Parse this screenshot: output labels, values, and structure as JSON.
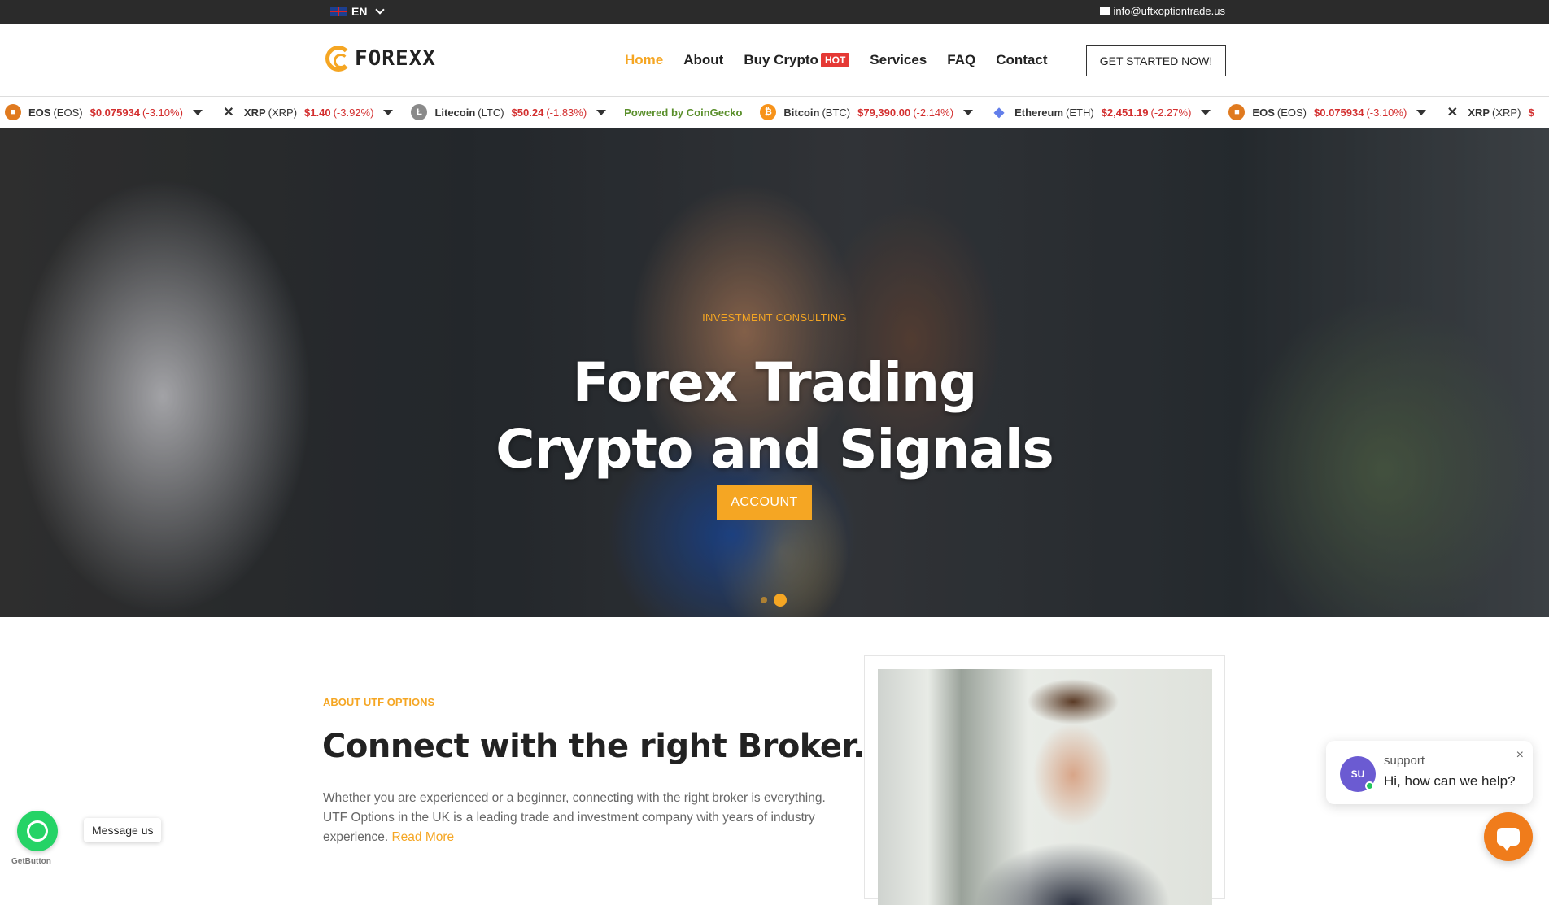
{
  "topbar": {
    "language": "EN",
    "email": "info@uftxoptiontrade.us"
  },
  "header": {
    "logo_text": "FOREXX",
    "nav": [
      {
        "label": "Home",
        "active": true
      },
      {
        "label": "About"
      },
      {
        "label": "Buy Crypto",
        "badge": "HOT"
      },
      {
        "label": "Services"
      },
      {
        "label": "FAQ"
      },
      {
        "label": "Contact"
      }
    ],
    "cta": "GET STARTED NOW!"
  },
  "ticker": {
    "items": [
      {
        "name": "EOS",
        "symbol": "(EOS)",
        "price": "$0.075934",
        "change": "(-3.10%)",
        "icon": "eos-icon",
        "color": "#e07a1f"
      },
      {
        "name": "XRP",
        "symbol": "(XRP)",
        "price": "$1.40",
        "change": "(-3.92%)",
        "icon": "xrp-icon",
        "color": "#333333"
      },
      {
        "name": "Litecoin",
        "symbol": "(LTC)",
        "price": "$50.24",
        "change": "(-1.83%)",
        "icon": "litecoin-icon",
        "color": "#8a8a8a"
      },
      {
        "name": "Bitcoin",
        "symbol": "(BTC)",
        "price": "$79,390.00",
        "change": "(-2.14%)",
        "icon": "bitcoin-icon",
        "color": "#f7931a"
      },
      {
        "name": "Ethereum",
        "symbol": "(ETH)",
        "price": "$2,451.19",
        "change": "(-2.27%)",
        "icon": "ethereum-icon",
        "color": "#627eea"
      },
      {
        "name": "EOS",
        "symbol": "(EOS)",
        "price": "$0.075934",
        "change": "(-3.10%)",
        "icon": "eos-icon",
        "color": "#e07a1f"
      },
      {
        "name": "XRP",
        "symbol": "(XRP)",
        "price": "$",
        "change": "",
        "icon": "xrp-icon",
        "color": "#333333"
      }
    ],
    "powered_prefix": "Powered by",
    "powered_brand": "CoinGecko"
  },
  "hero": {
    "eyebrow": "INVESTMENT CONSULTING",
    "title_line1": "Forex Trading",
    "title_line2": "Crypto and Signals",
    "button": "ACCOUNT",
    "slides": 2,
    "active_slide": 2
  },
  "about": {
    "eyebrow": "ABOUT UTF OPTIONS",
    "title": "Connect with the right Broker.",
    "text": "Whether you are experienced or a beginner, connecting with the right broker is everything. UTF Options in the UK is a leading trade and investment company with years of industry experience.",
    "read_more": "Read More"
  },
  "whatsapp": {
    "message": "Message us",
    "credit": "GetButton"
  },
  "chat": {
    "avatar": "SU",
    "name": "support",
    "message": "Hi, how can we help?",
    "close": "×"
  },
  "colors": {
    "accent": "#f5a623",
    "negative": "#d32f2f",
    "hot": "#e53935"
  }
}
